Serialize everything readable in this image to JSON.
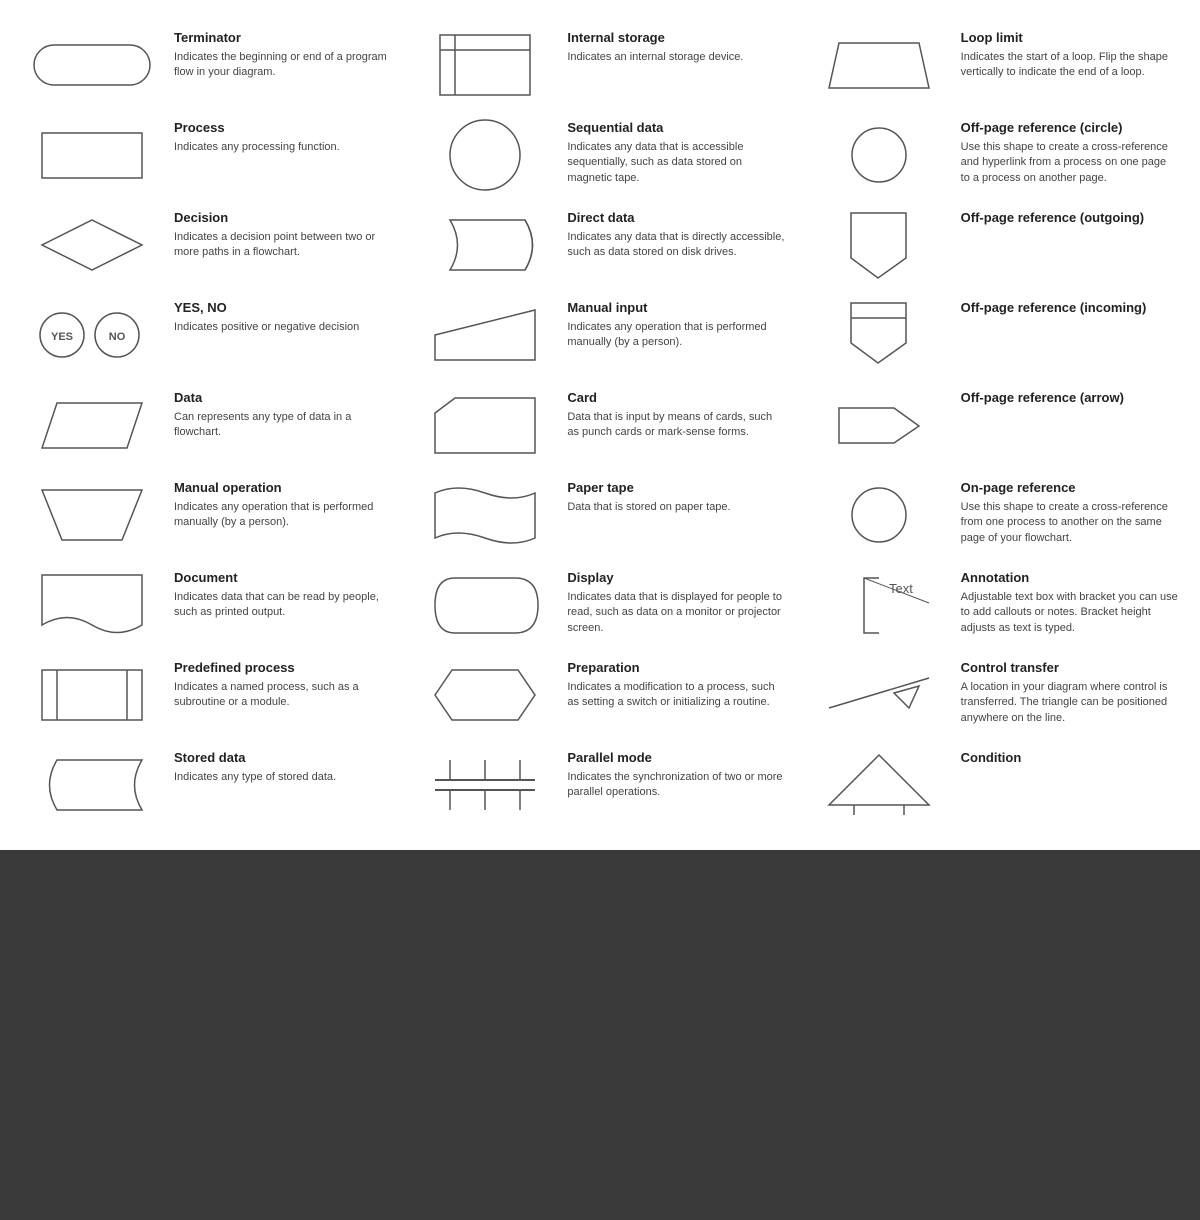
{
  "items": [
    {
      "id": "terminator",
      "title": "Terminator",
      "description": "Indicates the beginning or end of a program flow in your diagram.",
      "shape": "terminator"
    },
    {
      "id": "internal-storage",
      "title": "Internal storage",
      "description": "Indicates an internal storage device.",
      "shape": "internal-storage"
    },
    {
      "id": "loop-limit",
      "title": "Loop limit",
      "description": "Indicates the start of a loop. Flip the shape vertically to indicate the end of a loop.",
      "shape": "loop-limit"
    },
    {
      "id": "process",
      "title": "Process",
      "description": "Indicates any processing function.",
      "shape": "process"
    },
    {
      "id": "sequential-data",
      "title": "Sequential data",
      "description": "Indicates any data that is accessible sequentially, such as data stored on magnetic tape.",
      "shape": "sequential-data"
    },
    {
      "id": "off-page-circle",
      "title": "Off-page reference (circle)",
      "description": "Use this shape to create a cross-reference and hyperlink from a process on one page to a process on another page.",
      "shape": "off-page-circle"
    },
    {
      "id": "decision",
      "title": "Decision",
      "description": "Indicates a decision point between two or more paths in a flowchart.",
      "shape": "decision"
    },
    {
      "id": "direct-data",
      "title": "Direct data",
      "description": "Indicates any data that is directly accessible, such as data stored on disk drives.",
      "shape": "direct-data"
    },
    {
      "id": "off-page-outgoing",
      "title": "Off-page reference (outgoing)",
      "description": "",
      "shape": "off-page-outgoing"
    },
    {
      "id": "yes-no",
      "title": "YES, NO",
      "description": "Indicates positive or negative decision",
      "shape": "yes-no"
    },
    {
      "id": "manual-input",
      "title": "Manual input",
      "description": "Indicates any operation that is performed manually (by a person).",
      "shape": "manual-input"
    },
    {
      "id": "off-page-incoming",
      "title": "Off-page reference (incoming)",
      "description": "",
      "shape": "off-page-incoming"
    },
    {
      "id": "data",
      "title": "Data",
      "description": "Can represents any type of data in a flowchart.",
      "shape": "data"
    },
    {
      "id": "card",
      "title": "Card",
      "description": "Data that is input by means of cards, such as punch cards or mark-sense forms.",
      "shape": "card"
    },
    {
      "id": "off-page-arrow",
      "title": "Off-page reference (arrow)",
      "description": "",
      "shape": "off-page-arrow"
    },
    {
      "id": "manual-operation",
      "title": "Manual operation",
      "description": "Indicates any operation that is performed manually (by a person).",
      "shape": "manual-operation"
    },
    {
      "id": "paper-tape",
      "title": "Paper tape",
      "description": "Data that is stored on paper tape.",
      "shape": "paper-tape"
    },
    {
      "id": "on-page-reference",
      "title": "On-page reference",
      "description": "Use this shape to create a cross-reference from one process to another on the same page of your flowchart.",
      "shape": "on-page-reference"
    },
    {
      "id": "document",
      "title": "Document",
      "description": "Indicates data that can be read by people, such as printed output.",
      "shape": "document"
    },
    {
      "id": "display",
      "title": "Display",
      "description": "Indicates data that is displayed for people to read, such as data on a monitor or projector screen.",
      "shape": "display"
    },
    {
      "id": "annotation",
      "title": "Annotation",
      "description": "Adjustable text box with bracket you can use to add callouts or notes. Bracket height adjusts as text is typed.",
      "shape": "annotation"
    },
    {
      "id": "predefined-process",
      "title": "Predefined process",
      "description": "Indicates a named process, such as a subroutine or a module.",
      "shape": "predefined-process"
    },
    {
      "id": "preparation",
      "title": "Preparation",
      "description": "Indicates a modification to a process, such as setting a switch or initializing a routine.",
      "shape": "preparation"
    },
    {
      "id": "control-transfer",
      "title": "Control transfer",
      "description": "A location in your diagram where control is transferred. The triangle can be positioned anywhere on the line.",
      "shape": "control-transfer"
    },
    {
      "id": "stored-data",
      "title": "Stored data",
      "description": "Indicates any type of stored data.",
      "shape": "stored-data"
    },
    {
      "id": "parallel-mode",
      "title": "Parallel mode",
      "description": "Indicates the synchronization of two or more parallel operations.",
      "shape": "parallel-mode"
    },
    {
      "id": "condition",
      "title": "Condition",
      "description": "",
      "shape": "condition"
    }
  ]
}
